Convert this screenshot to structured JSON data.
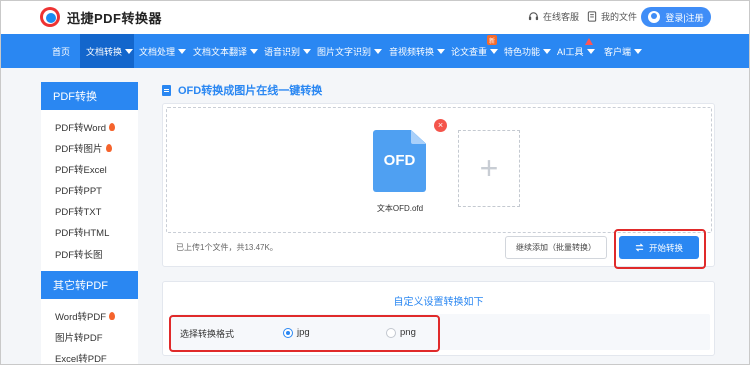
{
  "header": {
    "app_name": "迅捷PDF转换器",
    "service_label": "在线客服",
    "docs_label": "我的文件",
    "login_label": "登录|注册"
  },
  "nav": {
    "items": [
      {
        "label": "首页",
        "dropdown": false,
        "active": false
      },
      {
        "label": "文档转换",
        "dropdown": true,
        "active": true
      },
      {
        "label": "文档处理",
        "dropdown": true,
        "active": false
      },
      {
        "label": "文档文本翻译",
        "dropdown": true,
        "active": false
      },
      {
        "label": "语音识别",
        "dropdown": true,
        "active": false
      },
      {
        "label": "图片文字识别",
        "dropdown": true,
        "active": false
      },
      {
        "label": "音视频转换",
        "dropdown": true,
        "active": false
      },
      {
        "label": "论文查重",
        "dropdown": true,
        "active": false
      },
      {
        "label": "特色功能",
        "dropdown": true,
        "active": false
      },
      {
        "label": "AI工具",
        "dropdown": true,
        "active": false
      },
      {
        "label": "客户端",
        "dropdown": true,
        "active": false
      }
    ],
    "new_badge": "新"
  },
  "sidebar": {
    "pdf_convert_heading": "PDF转换",
    "pdf_convert_items": [
      {
        "label": "PDF转Word",
        "hot": true
      },
      {
        "label": "PDF转图片",
        "hot": true
      },
      {
        "label": "PDF转Excel",
        "hot": false
      },
      {
        "label": "PDF转PPT",
        "hot": false
      },
      {
        "label": "PDF转TXT",
        "hot": false
      },
      {
        "label": "PDF转HTML",
        "hot": false
      },
      {
        "label": "PDF转长图",
        "hot": false
      }
    ],
    "other_heading": "其它转PDF",
    "other_items": [
      {
        "label": "Word转PDF",
        "hot": true
      },
      {
        "label": "图片转PDF",
        "hot": false
      },
      {
        "label": "Excel转PDF",
        "hot": false
      }
    ]
  },
  "main": {
    "title": "OFD转换成图片在线一键转换",
    "file": {
      "type_label": "OFD",
      "name": "文本OFD.ofd",
      "remove_symbol": "×"
    },
    "add_symbol": "+",
    "summary": "已上传1个文件，共13.47K。",
    "add_more_button": "继续添加（批量转换）",
    "start_button": "开始转换",
    "settings_title": "自定义设置转换如下",
    "format_label": "选择转换格式",
    "formats": [
      {
        "label": "jpg",
        "selected": true
      },
      {
        "label": "png",
        "selected": false
      }
    ]
  },
  "colors": {
    "primary": "#2a87f2",
    "highlight": "#e02a2a",
    "hot": "#f5632c"
  }
}
